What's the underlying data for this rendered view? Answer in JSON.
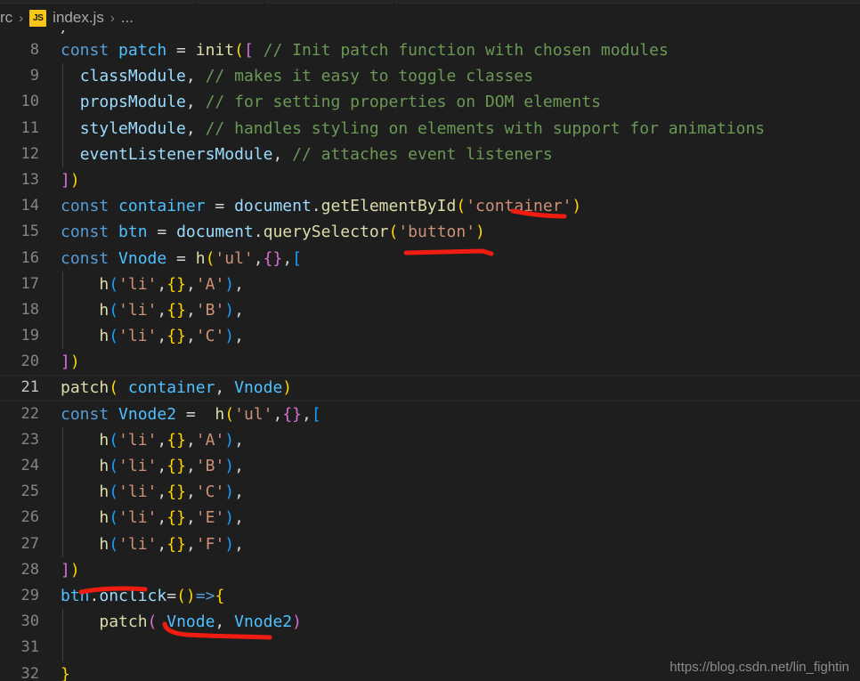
{
  "window": {
    "background_color": "#1e1e1e",
    "editor_background": "#1e1e1e"
  },
  "tabbar": {
    "visible_strip_only": true
  },
  "breadcrumb": {
    "folder": "rc",
    "separator": "›",
    "file_icon_label": "JS",
    "file": "index.js",
    "ellipsis": "..."
  },
  "editor": {
    "language": "javascript",
    "first_visible_line_number": 8,
    "current_line_number": 21,
    "partial_top_text": "/",
    "lines": [
      {
        "number": "8",
        "indent_guide": false,
        "current": false,
        "tokens": [
          {
            "t": "const ",
            "c": "t-kw"
          },
          {
            "t": "patch",
            "c": "t-var"
          },
          {
            "t": " = ",
            "c": "t-op"
          },
          {
            "t": "init",
            "c": "t-fn"
          },
          {
            "t": "(",
            "c": "t-y"
          },
          {
            "t": "[",
            "c": "t-m"
          },
          {
            "t": " ",
            "c": "t-op"
          },
          {
            "t": "// Init patch function with chosen modules",
            "c": "t-cmt"
          }
        ]
      },
      {
        "number": "9",
        "indent_guide": true,
        "current": false,
        "tokens": [
          {
            "t": "  ",
            "c": "t-op"
          },
          {
            "t": "classModule",
            "c": "t-prop"
          },
          {
            "t": ", ",
            "c": "t-op"
          },
          {
            "t": "// makes it easy to toggle classes",
            "c": "t-cmt"
          }
        ]
      },
      {
        "number": "10",
        "indent_guide": true,
        "current": false,
        "tokens": [
          {
            "t": "  ",
            "c": "t-op"
          },
          {
            "t": "propsModule",
            "c": "t-prop"
          },
          {
            "t": ", ",
            "c": "t-op"
          },
          {
            "t": "// for setting properties on DOM elements",
            "c": "t-cmt"
          }
        ]
      },
      {
        "number": "11",
        "indent_guide": true,
        "current": false,
        "tokens": [
          {
            "t": "  ",
            "c": "t-op"
          },
          {
            "t": "styleModule",
            "c": "t-prop"
          },
          {
            "t": ", ",
            "c": "t-op"
          },
          {
            "t": "// handles styling on elements with support for animations",
            "c": "t-cmt"
          }
        ]
      },
      {
        "number": "12",
        "indent_guide": true,
        "current": false,
        "tokens": [
          {
            "t": "  ",
            "c": "t-op"
          },
          {
            "t": "eventListenersModule",
            "c": "t-prop"
          },
          {
            "t": ", ",
            "c": "t-op"
          },
          {
            "t": "// attaches event listeners",
            "c": "t-cmt"
          }
        ]
      },
      {
        "number": "13",
        "indent_guide": false,
        "current": false,
        "tokens": [
          {
            "t": "]",
            "c": "t-m"
          },
          {
            "t": ")",
            "c": "t-y"
          }
        ]
      },
      {
        "number": "14",
        "indent_guide": false,
        "current": false,
        "tokens": [
          {
            "t": "const ",
            "c": "t-kw"
          },
          {
            "t": "container",
            "c": "t-var"
          },
          {
            "t": " = ",
            "c": "t-op"
          },
          {
            "t": "document",
            "c": "t-prop"
          },
          {
            "t": ".",
            "c": "t-op"
          },
          {
            "t": "getElementById",
            "c": "t-fn"
          },
          {
            "t": "(",
            "c": "t-y"
          },
          {
            "t": "'container'",
            "c": "t-str"
          },
          {
            "t": ")",
            "c": "t-y"
          }
        ]
      },
      {
        "number": "15",
        "indent_guide": false,
        "current": false,
        "tokens": [
          {
            "t": "const ",
            "c": "t-kw"
          },
          {
            "t": "btn",
            "c": "t-var"
          },
          {
            "t": " = ",
            "c": "t-op"
          },
          {
            "t": "document",
            "c": "t-prop"
          },
          {
            "t": ".",
            "c": "t-op"
          },
          {
            "t": "querySelector",
            "c": "t-fn"
          },
          {
            "t": "(",
            "c": "t-y"
          },
          {
            "t": "'button'",
            "c": "t-str"
          },
          {
            "t": ")",
            "c": "t-y"
          }
        ]
      },
      {
        "number": "16",
        "indent_guide": false,
        "current": false,
        "tokens": [
          {
            "t": "const ",
            "c": "t-kw"
          },
          {
            "t": "Vnode",
            "c": "t-var"
          },
          {
            "t": " = ",
            "c": "t-op"
          },
          {
            "t": "h",
            "c": "t-fn"
          },
          {
            "t": "(",
            "c": "t-y"
          },
          {
            "t": "'ul'",
            "c": "t-str"
          },
          {
            "t": ",",
            "c": "t-op"
          },
          {
            "t": "{}",
            "c": "t-m"
          },
          {
            "t": ",",
            "c": "t-op"
          },
          {
            "t": "[",
            "c": "t-b"
          }
        ]
      },
      {
        "number": "17",
        "indent_guide": true,
        "current": false,
        "tokens": [
          {
            "t": "    ",
            "c": "t-op"
          },
          {
            "t": "h",
            "c": "t-fn"
          },
          {
            "t": "(",
            "c": "t-b"
          },
          {
            "t": "'li'",
            "c": "t-str"
          },
          {
            "t": ",",
            "c": "t-op"
          },
          {
            "t": "{}",
            "c": "t-y"
          },
          {
            "t": ",",
            "c": "t-op"
          },
          {
            "t": "'A'",
            "c": "t-str"
          },
          {
            "t": ")",
            "c": "t-b"
          },
          {
            "t": ",",
            "c": "t-op"
          }
        ]
      },
      {
        "number": "18",
        "indent_guide": true,
        "current": false,
        "tokens": [
          {
            "t": "    ",
            "c": "t-op"
          },
          {
            "t": "h",
            "c": "t-fn"
          },
          {
            "t": "(",
            "c": "t-b"
          },
          {
            "t": "'li'",
            "c": "t-str"
          },
          {
            "t": ",",
            "c": "t-op"
          },
          {
            "t": "{}",
            "c": "t-y"
          },
          {
            "t": ",",
            "c": "t-op"
          },
          {
            "t": "'B'",
            "c": "t-str"
          },
          {
            "t": ")",
            "c": "t-b"
          },
          {
            "t": ",",
            "c": "t-op"
          }
        ]
      },
      {
        "number": "19",
        "indent_guide": true,
        "current": false,
        "tokens": [
          {
            "t": "    ",
            "c": "t-op"
          },
          {
            "t": "h",
            "c": "t-fn"
          },
          {
            "t": "(",
            "c": "t-b"
          },
          {
            "t": "'li'",
            "c": "t-str"
          },
          {
            "t": ",",
            "c": "t-op"
          },
          {
            "t": "{}",
            "c": "t-y"
          },
          {
            "t": ",",
            "c": "t-op"
          },
          {
            "t": "'C'",
            "c": "t-str"
          },
          {
            "t": ")",
            "c": "t-b"
          },
          {
            "t": ",",
            "c": "t-op"
          }
        ]
      },
      {
        "number": "20",
        "indent_guide": false,
        "current": false,
        "tokens": [
          {
            "t": "]",
            "c": "t-m"
          },
          {
            "t": ")",
            "c": "t-y"
          }
        ]
      },
      {
        "number": "21",
        "indent_guide": false,
        "current": true,
        "tokens": [
          {
            "t": "patch",
            "c": "t-fn"
          },
          {
            "t": "(",
            "c": "t-y"
          },
          {
            "t": " ",
            "c": "t-op"
          },
          {
            "t": "container",
            "c": "t-var"
          },
          {
            "t": ", ",
            "c": "t-op"
          },
          {
            "t": "Vnode",
            "c": "t-var"
          },
          {
            "t": ")",
            "c": "t-y"
          }
        ]
      },
      {
        "number": "22",
        "indent_guide": false,
        "current": false,
        "tokens": [
          {
            "t": "const ",
            "c": "t-kw"
          },
          {
            "t": "Vnode2",
            "c": "t-var"
          },
          {
            "t": " = ",
            "c": "t-op"
          },
          {
            "t": " ",
            "c": "t-op"
          },
          {
            "t": "h",
            "c": "t-fn"
          },
          {
            "t": "(",
            "c": "t-y"
          },
          {
            "t": "'ul'",
            "c": "t-str"
          },
          {
            "t": ",",
            "c": "t-op"
          },
          {
            "t": "{}",
            "c": "t-m"
          },
          {
            "t": ",",
            "c": "t-op"
          },
          {
            "t": "[",
            "c": "t-b"
          }
        ]
      },
      {
        "number": "23",
        "indent_guide": true,
        "current": false,
        "tokens": [
          {
            "t": "    ",
            "c": "t-op"
          },
          {
            "t": "h",
            "c": "t-fn"
          },
          {
            "t": "(",
            "c": "t-b"
          },
          {
            "t": "'li'",
            "c": "t-str"
          },
          {
            "t": ",",
            "c": "t-op"
          },
          {
            "t": "{}",
            "c": "t-y"
          },
          {
            "t": ",",
            "c": "t-op"
          },
          {
            "t": "'A'",
            "c": "t-str"
          },
          {
            "t": ")",
            "c": "t-b"
          },
          {
            "t": ",",
            "c": "t-op"
          }
        ]
      },
      {
        "number": "24",
        "indent_guide": true,
        "current": false,
        "tokens": [
          {
            "t": "    ",
            "c": "t-op"
          },
          {
            "t": "h",
            "c": "t-fn"
          },
          {
            "t": "(",
            "c": "t-b"
          },
          {
            "t": "'li'",
            "c": "t-str"
          },
          {
            "t": ",",
            "c": "t-op"
          },
          {
            "t": "{}",
            "c": "t-y"
          },
          {
            "t": ",",
            "c": "t-op"
          },
          {
            "t": "'B'",
            "c": "t-str"
          },
          {
            "t": ")",
            "c": "t-b"
          },
          {
            "t": ",",
            "c": "t-op"
          }
        ]
      },
      {
        "number": "25",
        "indent_guide": true,
        "current": false,
        "tokens": [
          {
            "t": "    ",
            "c": "t-op"
          },
          {
            "t": "h",
            "c": "t-fn"
          },
          {
            "t": "(",
            "c": "t-b"
          },
          {
            "t": "'li'",
            "c": "t-str"
          },
          {
            "t": ",",
            "c": "t-op"
          },
          {
            "t": "{}",
            "c": "t-y"
          },
          {
            "t": ",",
            "c": "t-op"
          },
          {
            "t": "'C'",
            "c": "t-str"
          },
          {
            "t": ")",
            "c": "t-b"
          },
          {
            "t": ",",
            "c": "t-op"
          }
        ]
      },
      {
        "number": "26",
        "indent_guide": true,
        "current": false,
        "tokens": [
          {
            "t": "    ",
            "c": "t-op"
          },
          {
            "t": "h",
            "c": "t-fn"
          },
          {
            "t": "(",
            "c": "t-b"
          },
          {
            "t": "'li'",
            "c": "t-str"
          },
          {
            "t": ",",
            "c": "t-op"
          },
          {
            "t": "{}",
            "c": "t-y"
          },
          {
            "t": ",",
            "c": "t-op"
          },
          {
            "t": "'E'",
            "c": "t-str"
          },
          {
            "t": ")",
            "c": "t-b"
          },
          {
            "t": ",",
            "c": "t-op"
          }
        ]
      },
      {
        "number": "27",
        "indent_guide": true,
        "current": false,
        "tokens": [
          {
            "t": "    ",
            "c": "t-op"
          },
          {
            "t": "h",
            "c": "t-fn"
          },
          {
            "t": "(",
            "c": "t-b"
          },
          {
            "t": "'li'",
            "c": "t-str"
          },
          {
            "t": ",",
            "c": "t-op"
          },
          {
            "t": "{}",
            "c": "t-y"
          },
          {
            "t": ",",
            "c": "t-op"
          },
          {
            "t": "'F'",
            "c": "t-str"
          },
          {
            "t": ")",
            "c": "t-b"
          },
          {
            "t": ",",
            "c": "t-op"
          }
        ]
      },
      {
        "number": "28",
        "indent_guide": false,
        "current": false,
        "tokens": [
          {
            "t": "]",
            "c": "t-m"
          },
          {
            "t": ")",
            "c": "t-y"
          }
        ]
      },
      {
        "number": "29",
        "indent_guide": false,
        "current": false,
        "tokens": [
          {
            "t": "btn",
            "c": "t-var"
          },
          {
            "t": ".",
            "c": "t-op"
          },
          {
            "t": "onclick",
            "c": "t-prop"
          },
          {
            "t": "=",
            "c": "t-op"
          },
          {
            "t": "()",
            "c": "t-y"
          },
          {
            "t": "=>",
            "c": "t-kw"
          },
          {
            "t": "{",
            "c": "t-y"
          }
        ]
      },
      {
        "number": "30",
        "indent_guide": true,
        "current": false,
        "tokens": [
          {
            "t": "    ",
            "c": "t-op"
          },
          {
            "t": "patch",
            "c": "t-fn"
          },
          {
            "t": "(",
            "c": "t-m"
          },
          {
            "t": " ",
            "c": "t-op"
          },
          {
            "t": "Vnode",
            "c": "t-var"
          },
          {
            "t": ", ",
            "c": "t-op"
          },
          {
            "t": "Vnode2",
            "c": "t-var"
          },
          {
            "t": ")",
            "c": "t-m"
          }
        ]
      },
      {
        "number": "31",
        "indent_guide": true,
        "current": false,
        "tokens": []
      },
      {
        "number": "32",
        "indent_guide": false,
        "current": false,
        "tokens": [
          {
            "t": "}",
            "c": "t-y"
          }
        ]
      }
    ]
  },
  "annotations": {
    "color": "#f01c12",
    "strokes": [
      {
        "name": "underline-container",
        "desc": "slanted underline beneath 'container' string literal"
      },
      {
        "name": "underline-button",
        "desc": "straight underline beneath 'button' selector area"
      },
      {
        "name": "underline-onclick",
        "desc": "underline beneath btn.onclick"
      },
      {
        "name": "underline-patch-call",
        "desc": "hooked underline beneath patch( Vnode, Vnode2)"
      }
    ]
  },
  "watermark": {
    "text": "https://blog.csdn.net/lin_fightin"
  }
}
